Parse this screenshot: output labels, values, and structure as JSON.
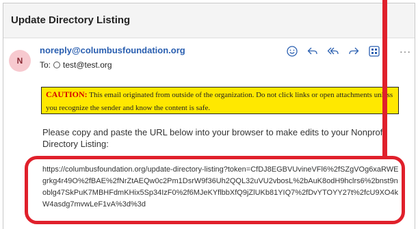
{
  "email": {
    "subject": "Update Directory Listing",
    "avatar_initial": "N",
    "sender": "noreply@columbusfoundation.org",
    "to_label": "To:",
    "to_address": "test@test.org",
    "actions": [
      "emoji-icon",
      "reply-icon",
      "reply-all-icon",
      "forward-icon",
      "apps-icon"
    ],
    "more": "···",
    "caution": {
      "title": "CAUTION:",
      "text": "This email originated from outside of the organization. Do not click links or open attachments unless you recognize the sender and know the content is safe."
    },
    "body": "Please copy and paste the URL below into your browser to make edits to your Nonprofit Directory Listing:",
    "url": "https://columbusfoundation.org/update-directory-listing?token=CfDJ8EGBVUvineVFl6%2fSZgVOg6xaRWEgrkg4r49O%2fBAE%2fNrZtAEQw0c2Pm1DsrW9f36Uh2QQL32uVU2vbosL%2bAuK8odH9hclrs6%2bnst9noblg47SkPuK7MBHFdmKHix5Sp34IzF0%2f6MJeKYflbbXfQ9jZlUKb81YIQ7%2fDvYTOYY27t%2fcU9XO4kW4asdg7mvwLeF1vA%3d%3d"
  },
  "colors": {
    "callout": "#e0202b",
    "caution_bg": "#ffe800",
    "caution_title": "#d40000",
    "sender": "#2a5fb0",
    "action_icons": "#2a5fb0"
  }
}
